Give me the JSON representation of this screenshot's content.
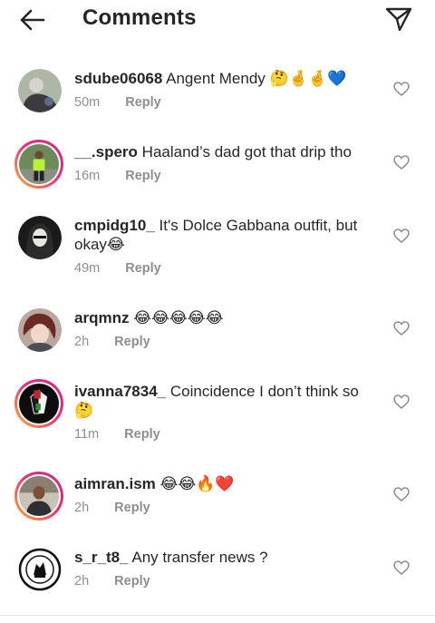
{
  "header": {
    "title": "Comments",
    "back_icon": "arrow-left-icon",
    "send_icon": "paper-plane-icon"
  },
  "comments": [
    {
      "username": "sdube06068",
      "text": "Angent Mendy",
      "emoji": "🤔🤞🤞💙",
      "time": "50m",
      "reply": "Reply"
    },
    {
      "username": "__.spero",
      "text": "Haaland’s dad got that drip tho",
      "emoji": "",
      "time": "16m",
      "reply": "Reply"
    },
    {
      "username": "cmpidg10_",
      "text": "It's Dolce Gabbana outfit, but okay",
      "emoji": "😂",
      "time": "49m",
      "reply": "Reply"
    },
    {
      "username": "arqmnz",
      "text": "",
      "emoji": "😂😂😂😂😂",
      "time": "2h",
      "reply": "Reply"
    },
    {
      "username": "ivanna7834_",
      "text": "Coincidence I don’t think  so",
      "emoji": "🤔",
      "time": "11m",
      "reply": "Reply"
    },
    {
      "username": "aimran.ism",
      "text": "",
      "emoji": "😂😂🔥❤️",
      "time": "2h",
      "reply": "Reply"
    },
    {
      "username": "s_r_t8_",
      "text": "Any transfer news ?",
      "emoji": "",
      "time": "2h",
      "reply": "Reply"
    }
  ],
  "colors": {
    "text": "#262626",
    "muted": "#8e8e8e",
    "story_ring_start": "#f9b233",
    "story_ring_end": "#c22d8b"
  }
}
